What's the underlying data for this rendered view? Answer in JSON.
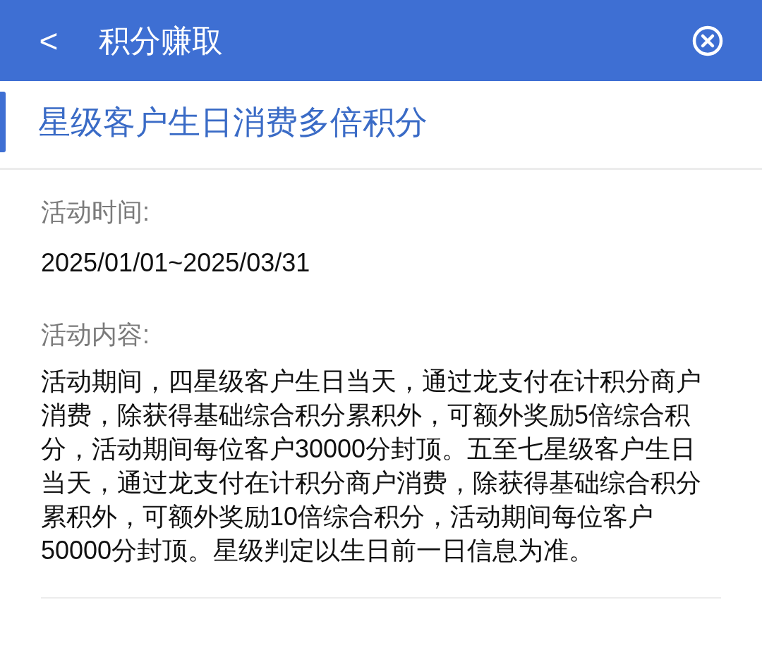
{
  "header": {
    "back": "<",
    "title": "积分赚取"
  },
  "activity": {
    "title": "星级客户生日消费多倍积分",
    "time_label": "活动时间:",
    "time_value": "2025/01/01~2025/03/31",
    "content_label": "活动内容:",
    "content": "活动期间，四星级客户生日当天，通过龙支付在计积分商户消费，除获得基础综合积分累积外，可额外奖励5倍综合积分，活动期间每位客户30000分封顶。五至七星级客户生日当天，通过龙支付在计积分商户消费，除获得基础综合积分累积外，可额外奖励10倍综合积分，活动期间每位客户50000分封顶。星级判定以生日前一日信息为准。"
  }
}
